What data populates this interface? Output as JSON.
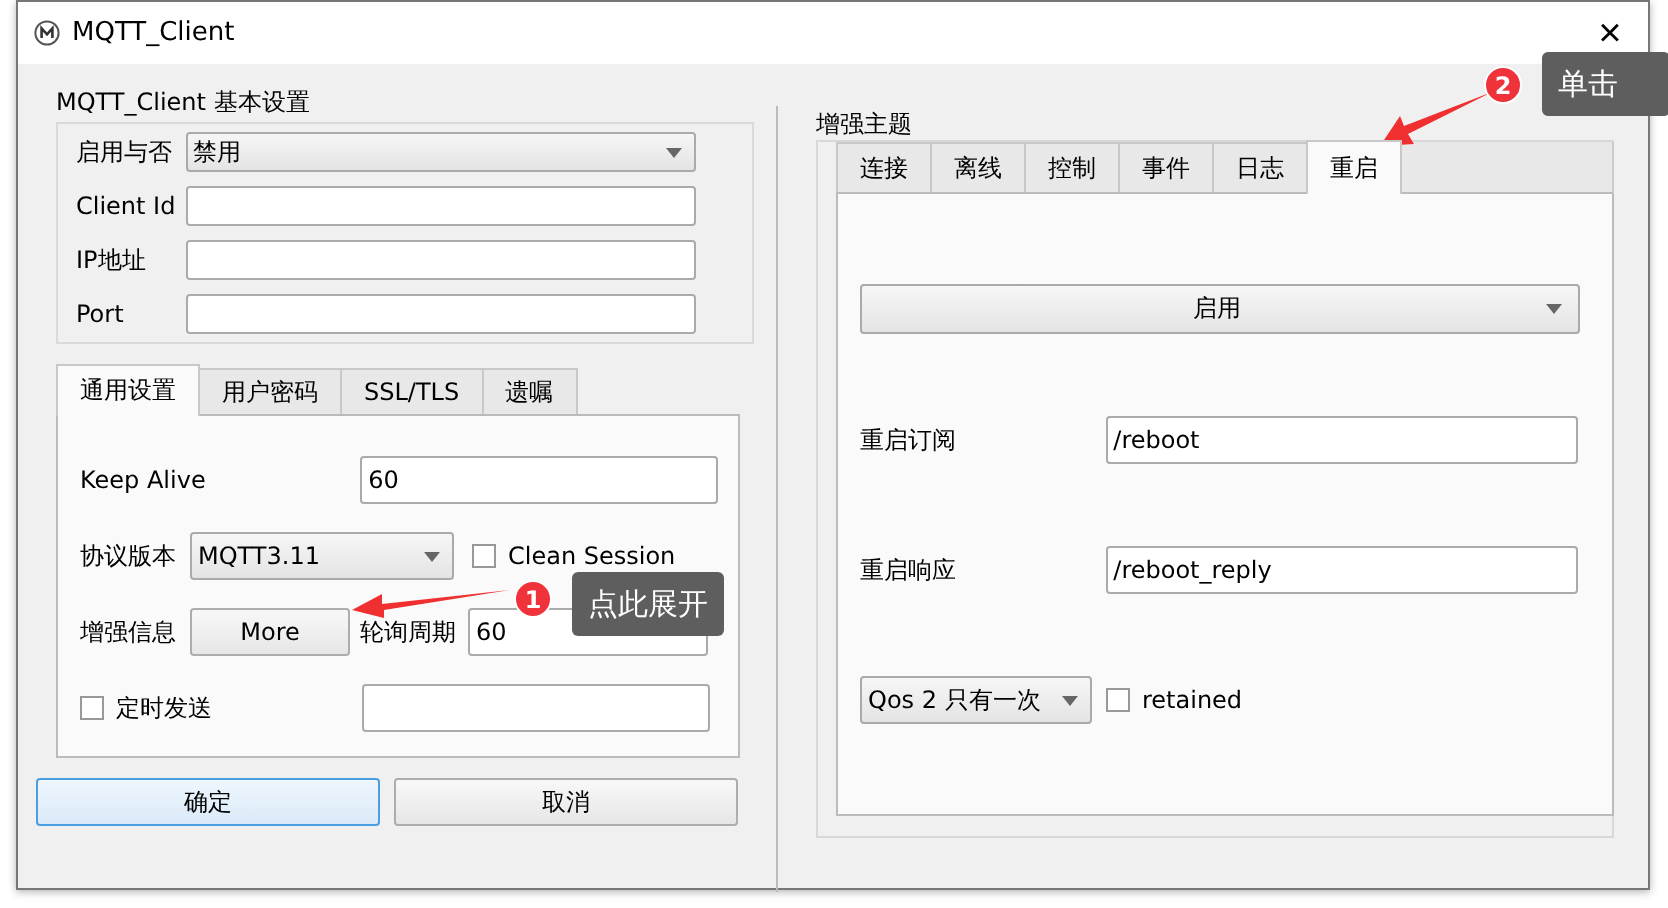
{
  "window": {
    "title": "MQTT_Client",
    "close": "×"
  },
  "basic": {
    "title": "MQTT_Client 基本设置",
    "rows": [
      {
        "label": "启用与否",
        "kind": "combo",
        "value": "禁用"
      },
      {
        "label": "Client Id",
        "kind": "field"
      },
      {
        "label": "IP地址",
        "kind": "field"
      },
      {
        "label": "Port",
        "kind": "field"
      }
    ]
  },
  "left_tabs": [
    {
      "label": "通用设置",
      "selected": true
    },
    {
      "label": "用户密码",
      "selected": false
    },
    {
      "label": "SSL/TLS",
      "selected": false
    },
    {
      "label": "遗嘱",
      "selected": false
    }
  ],
  "general": {
    "keep_alive": {
      "label": "Keep Alive",
      "value": "60"
    },
    "protocol": {
      "label": "协议版本",
      "value": "MQTT3.11"
    },
    "clean_session": {
      "label": "Clean Session",
      "checked": false
    },
    "enhanced": {
      "label": "增强信息",
      "button": "More"
    },
    "poll": {
      "label": "轮询周期",
      "value": "60"
    },
    "timed_send": {
      "label": "定时发送",
      "checked": false
    }
  },
  "buttons": [
    {
      "label": "确定",
      "focused": true
    },
    {
      "label": "取消",
      "focused": false
    }
  ],
  "topics": {
    "title": "增强主题",
    "tabs": [
      {
        "label": "连接",
        "selected": false
      },
      {
        "label": "离线",
        "selected": false
      },
      {
        "label": "控制",
        "selected": false
      },
      {
        "label": "事件",
        "selected": false
      },
      {
        "label": "日志",
        "selected": false
      },
      {
        "label": "重启",
        "selected": true
      }
    ],
    "enable": "启用",
    "subscribe": {
      "label": "重启订阅",
      "value": "/reboot"
    },
    "reply": {
      "label": "重启响应",
      "value": "/reboot_reply"
    },
    "qos": "Qos 2 只有一次",
    "retained": {
      "label": "retained",
      "checked": false
    }
  },
  "annotations": [
    {
      "number": "1",
      "text": "点此展开"
    },
    {
      "number": "2",
      "text": "单击"
    }
  ]
}
